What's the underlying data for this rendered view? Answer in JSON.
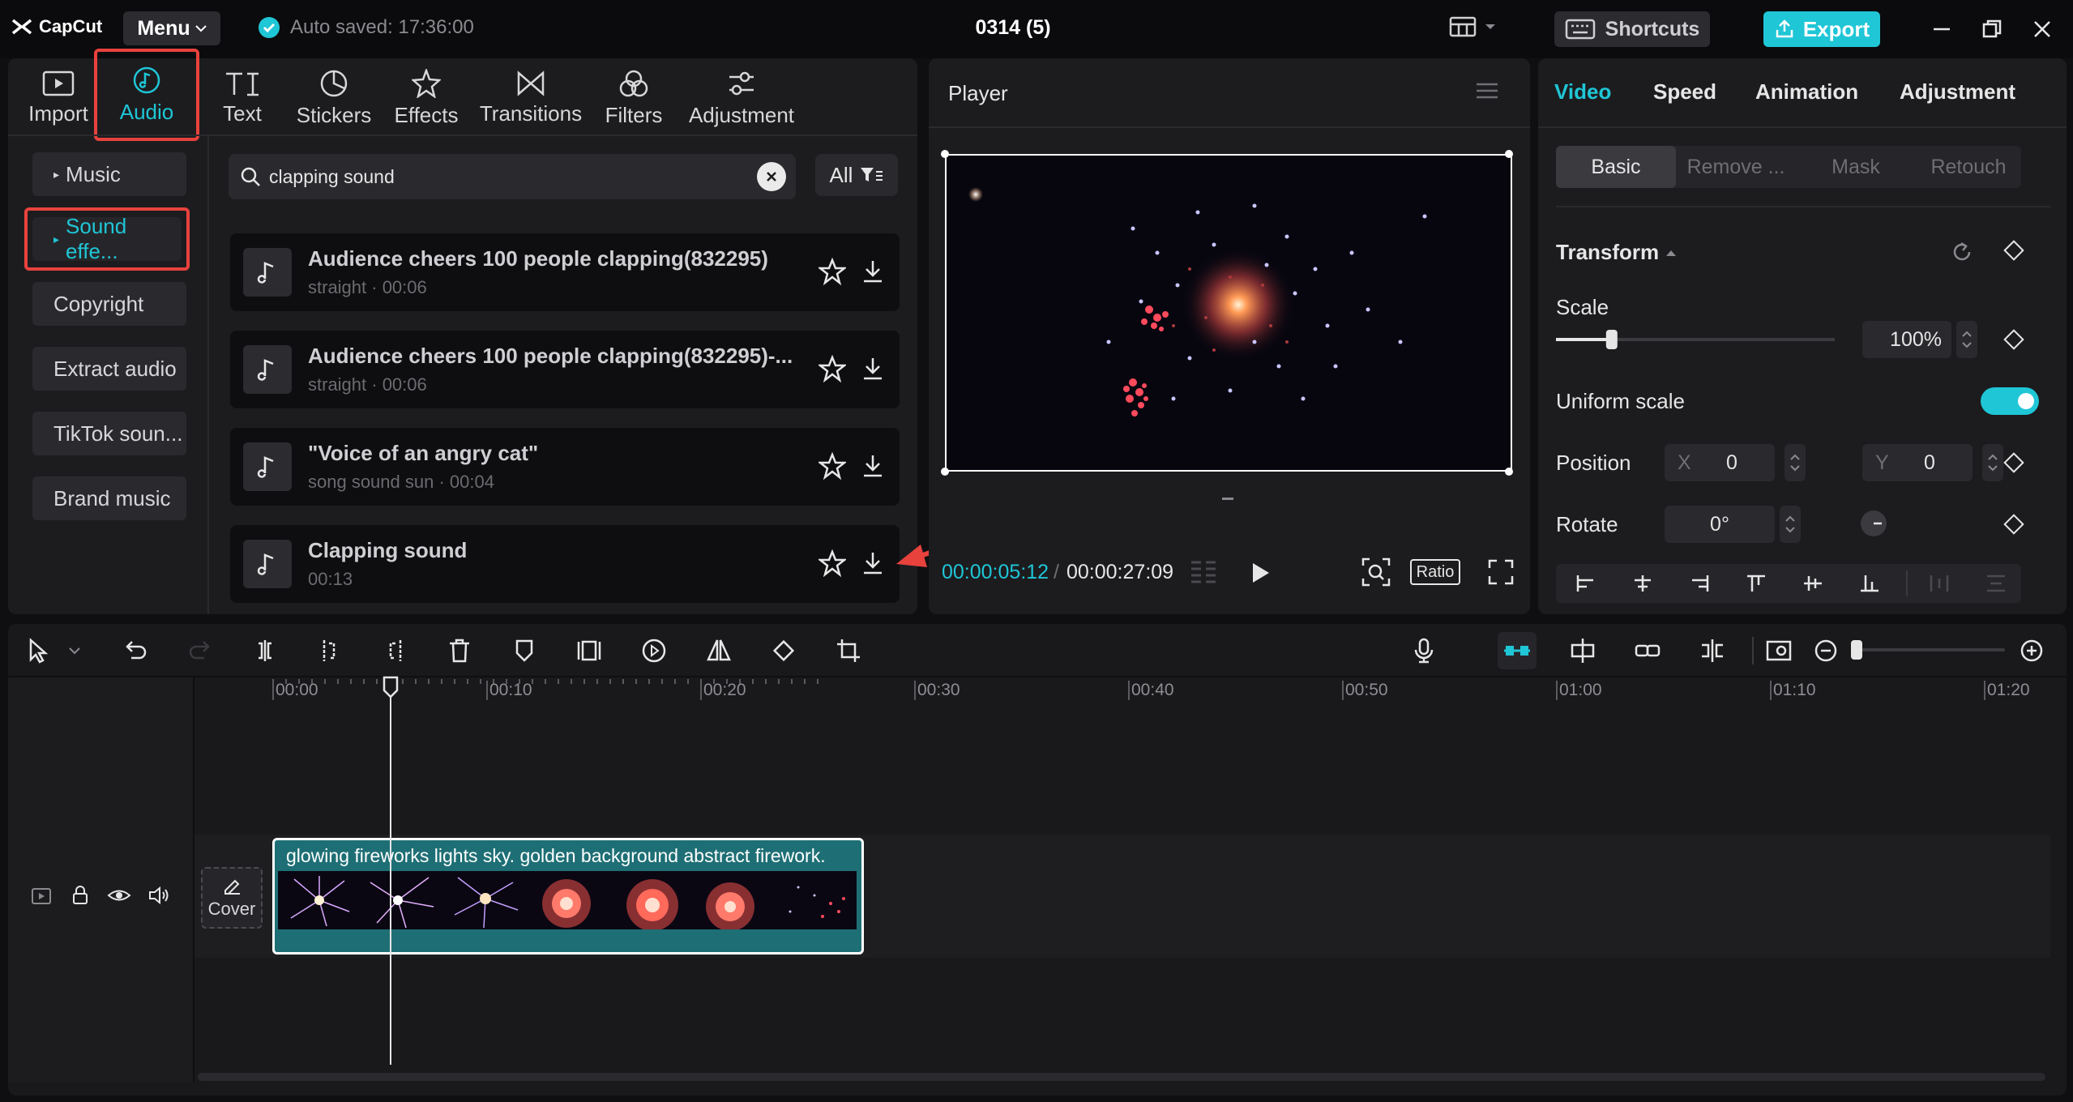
{
  "app": {
    "logo_text": "CapCut",
    "menu_label": "Menu",
    "autosave": "Auto saved: 17:36:00",
    "project_title": "0314 (5)",
    "shortcuts_label": "Shortcuts",
    "export_label": "Export"
  },
  "toolbar": {
    "tabs": [
      {
        "label": "Import",
        "icon": "import-icon"
      },
      {
        "label": "Audio",
        "icon": "audio-icon",
        "active": true
      },
      {
        "label": "Text",
        "icon": "text-icon"
      },
      {
        "label": "Stickers",
        "icon": "sticker-icon"
      },
      {
        "label": "Effects",
        "icon": "effects-icon"
      },
      {
        "label": "Transitions",
        "icon": "transitions-icon"
      },
      {
        "label": "Filters",
        "icon": "filters-icon"
      },
      {
        "label": "Adjustment",
        "icon": "adjustment-icon"
      }
    ]
  },
  "audio": {
    "categories": [
      "Music",
      "Sound effe...",
      "Copyright",
      "Extract audio",
      "TikTok soun...",
      "Brand music"
    ],
    "search_value": "clapping sound",
    "filter_label": "All",
    "results": [
      {
        "title": "Audience cheers 100 people clapping(832295)",
        "meta": "straight · 00:06"
      },
      {
        "title": "Audience cheers 100 people clapping(832295)-...",
        "meta": "straight · 00:06"
      },
      {
        "title": "\"Voice of an angry cat\"",
        "meta": "song sound sun · 00:04"
      },
      {
        "title": "Clapping sound",
        "meta": "00:13"
      }
    ]
  },
  "player": {
    "title": "Player",
    "current_time": "00:00:05:12",
    "total_time": "00:00:27:09",
    "ratio_label": "Ratio"
  },
  "properties": {
    "tabs": [
      "Video",
      "Speed",
      "Animation",
      "Adjustment"
    ],
    "subtabs": [
      "Basic",
      "Remove ...",
      "Mask",
      "Retouch"
    ],
    "transform_label": "Transform",
    "scale_label": "Scale",
    "scale_value": "100%",
    "scale_level": 0.2,
    "uniform_label": "Uniform scale",
    "position_label": "Position",
    "pos_x_label": "X",
    "pos_x": "0",
    "pos_y_label": "Y",
    "pos_y": "0",
    "rotate_label": "Rotate",
    "rotate_value": "0°"
  },
  "timeline": {
    "ticks": [
      "00:00",
      "00:10",
      "00:20",
      "00:30",
      "00:40",
      "00:50",
      "01:00",
      "01:10",
      "01:20"
    ],
    "clip_title": "glowing fireworks lights sky. golden background abstract firework.",
    "cover_label": "Cover"
  },
  "colors": {
    "accent": "#1fc6d6",
    "highlight": "#e8423d",
    "clip": "#1e6f75"
  }
}
